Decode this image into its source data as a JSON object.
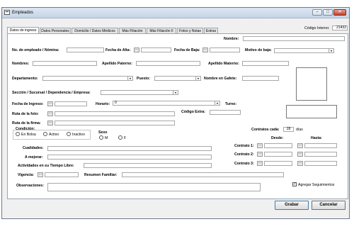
{
  "window": {
    "title": "Empleados"
  },
  "window_buttons": {
    "minimize": "–",
    "maximize": "□",
    "close": "✕"
  },
  "tabs": [
    {
      "label": "Datos de ingreso"
    },
    {
      "label": "Datos Personales"
    },
    {
      "label": "Domicilio / Datos Médicos"
    },
    {
      "label": "Más Filiación"
    },
    {
      "label": "Más Filiación II"
    },
    {
      "label": "Fotos y Notas"
    },
    {
      "label": "Extras"
    }
  ],
  "header": {
    "codigo_interno_label": "Código Interno:",
    "codigo_interno_value": "21432"
  },
  "form": {
    "nombre": "Nombre:",
    "no_empleado": "No. de empleado / Nómina:",
    "fecha_alta": "Fecha de Alta:",
    "fecha_baja": "Fecha de Baja:",
    "motivo_baja": "Motivo de baja:",
    "nombres": "Nombres:",
    "apellido_paterno": "Apellido Paterno:",
    "apellido_materno": "Apellido Materno:",
    "departamento": "Departamento:",
    "puesto": "Puesto:",
    "nombre_gafete": "Nombre en Gafete:",
    "seccion": "Sección / Sucursal / Dependencia / Empresa:",
    "fecha_ingreso": "Fecha de Ingreso:",
    "horario": "Horario:",
    "horario_value": "0",
    "turno": "Turno:",
    "ruta_foto": "Ruta de la foto:",
    "codigo_extra": "Código Extra:",
    "ruta_firma": "Ruta de la firma:",
    "condicion": "Condición:",
    "condicion_options": [
      "En Bolsa",
      "Activo",
      "Inactivo"
    ],
    "sexo": "Sexo",
    "sexo_options": [
      "M",
      "F"
    ],
    "contratos_cada": "Contratos cada:",
    "contratos_value": "28",
    "contratos_unit": "días",
    "desde": "Desde:",
    "hasta": "Hasta:",
    "cualidades": "Cualidades:",
    "a_mejorar": "A mejorar:",
    "actividades": "Actividades en su Tiempo Libre:",
    "vigencia": "Vigencia:",
    "resumen_familiar": "Resumen Familiar:",
    "observaciones": "Observaciones:",
    "contrato_1": "Contrato 1:",
    "contrato_2": "Contrato 2:",
    "contrato_3": "Contrato 3:",
    "agregar_seguimientos": "Agregar Seguimientos",
    "agregar_seguimientos_checked": "✓"
  },
  "buttons": {
    "grabar": "Grabar",
    "cancelar": "Cancelar"
  },
  "icons": {
    "calendar_button": "...",
    "dropdown": "▾"
  }
}
